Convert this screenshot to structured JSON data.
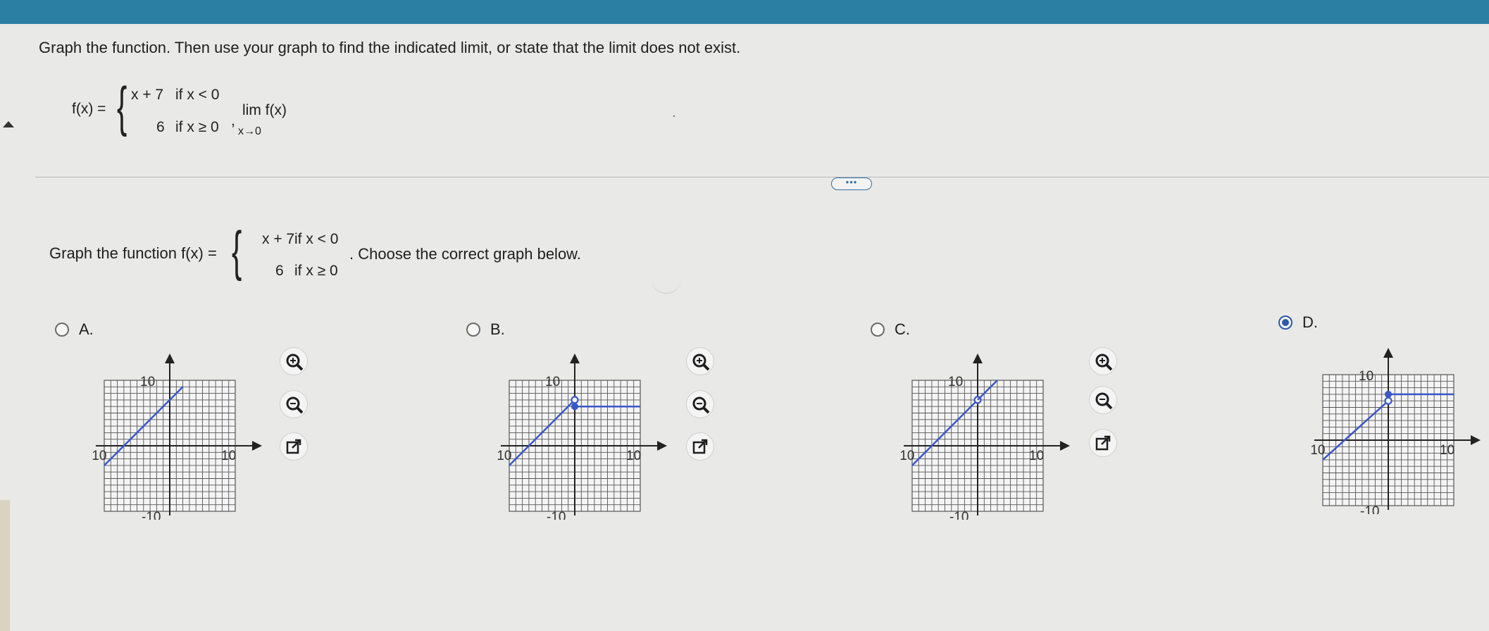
{
  "question": {
    "prompt": "Graph the function. Then use your graph to find the indicated limit, or state that the limit does not exist.",
    "fx_label": "f(x) =",
    "piece1_expr": "x + 7",
    "piece1_cond": "if x < 0",
    "piece2_expr": "6",
    "piece2_cond": "if x ≥ 0",
    "comma": ",",
    "limit_word": "lim f(x)",
    "limit_sub": "x→0",
    "period": "."
  },
  "more_button": "•••",
  "part": {
    "prefix": "Graph the function f(x) =",
    "piece1_expr": "x + 7",
    "piece1_cond": "if x < 0",
    "piece2_expr": "6",
    "piece2_cond": "if x ≥ 0",
    "suffix": ". Choose the correct graph below."
  },
  "options": [
    {
      "label": "A.",
      "selected": false
    },
    {
      "label": "B.",
      "selected": false
    },
    {
      "label": "C.",
      "selected": false
    },
    {
      "label": "D.",
      "selected": true
    }
  ],
  "graph_ticks": {
    "ymax": "10",
    "xmin": "-10",
    "xmax": "10",
    "ymin": "-10"
  },
  "graph_colors": {
    "line": "#3a56c8",
    "grid": "#555555",
    "axis": "#222222"
  },
  "icons": [
    "zoom-in-icon",
    "zoom-out-icon",
    "external-link-icon"
  ],
  "chart_data": [
    {
      "type": "line",
      "title": "A",
      "xlim": [
        -10,
        10
      ],
      "ylim": [
        -10,
        10
      ],
      "series": [
        {
          "values": [
            [
              -10,
              -3
            ],
            [
              2,
              9
            ]
          ]
        }
      ]
    },
    {
      "type": "line",
      "title": "B",
      "xlim": [
        -10,
        10
      ],
      "ylim": [
        -10,
        10
      ],
      "series": [
        {
          "values": [
            [
              -10,
              -3
            ],
            [
              0,
              7
            ]
          ],
          "end": "open"
        },
        {
          "values": [
            [
              0,
              6
            ],
            [
              10,
              6
            ]
          ],
          "start": "closed"
        }
      ]
    },
    {
      "type": "line",
      "title": "C",
      "xlim": [
        -10,
        10
      ],
      "ylim": [
        -10,
        10
      ],
      "series": [
        {
          "values": [
            [
              -10,
              -3
            ],
            [
              0,
              7
            ]
          ],
          "end": "open"
        },
        {
          "values": [
            [
              0,
              7
            ],
            [
              3,
              10
            ]
          ]
        }
      ]
    },
    {
      "type": "line",
      "title": "D",
      "xlim": [
        -10,
        10
      ],
      "ylim": [
        -10,
        10
      ],
      "series": [
        {
          "values": [
            [
              -10,
              -3
            ],
            [
              0,
              6
            ]
          ],
          "end": "open"
        },
        {
          "values": [
            [
              0,
              7
            ],
            [
              10,
              7
            ]
          ],
          "start": "closed"
        }
      ]
    }
  ]
}
